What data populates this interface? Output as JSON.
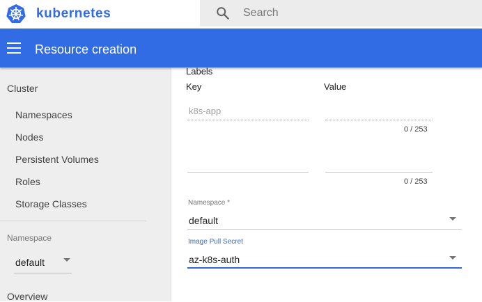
{
  "app": {
    "brand": "kubernetes"
  },
  "search": {
    "placeholder": "Search"
  },
  "toolbar": {
    "title": "Resource creation"
  },
  "sidebar": {
    "cluster_heading": "Cluster",
    "items": [
      "Namespaces",
      "Nodes",
      "Persistent Volumes",
      "Roles",
      "Storage Classes"
    ],
    "namespace_label": "Namespace",
    "namespace_value": "default",
    "overview": "Overview"
  },
  "form": {
    "labels_title": "Labels",
    "key_header": "Key",
    "value_header": "Value",
    "rows": [
      {
        "key_placeholder": "k8s-app",
        "counter": "0 / 253"
      },
      {
        "key_placeholder": "",
        "counter": "0 / 253"
      }
    ],
    "namespace_field": {
      "label": "Namespace *",
      "value": "default"
    },
    "image_pull_secret": {
      "label": "Image Pull Secret",
      "value": "az-k8s-auth"
    }
  },
  "colors": {
    "brand_blue": "#326ce5",
    "focus_blue": "#3367d6"
  }
}
